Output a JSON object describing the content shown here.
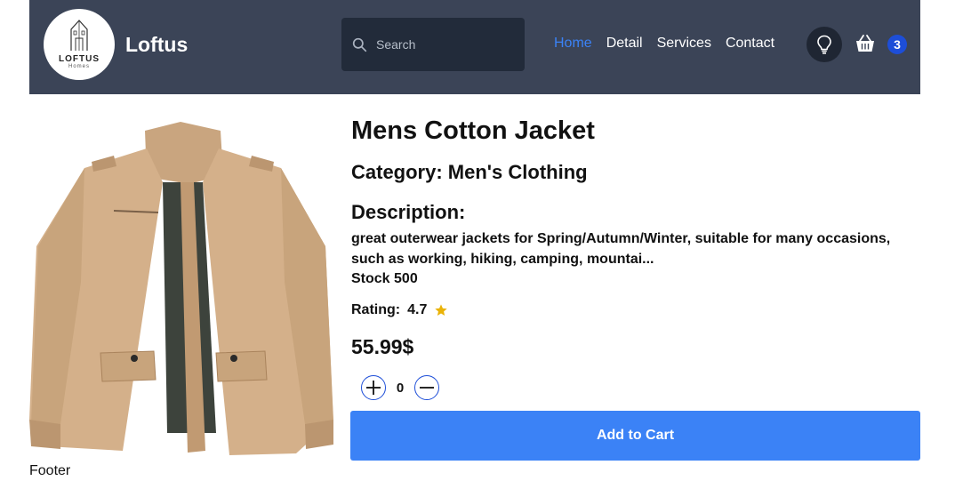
{
  "header": {
    "brand": "Loftus",
    "logo_text": "LOFTUS",
    "logo_subtext": "Homes",
    "search": {
      "placeholder": "Search"
    },
    "nav": [
      {
        "label": "Home",
        "active": true
      },
      {
        "label": "Detail",
        "active": false
      },
      {
        "label": "Services",
        "active": false
      },
      {
        "label": "Contact",
        "active": false
      }
    ],
    "cart_count": "3"
  },
  "product": {
    "title": "Mens Cotton Jacket",
    "category": "Category: Men's Clothing",
    "description_heading": "Description:",
    "description": "great outerwear jackets for Spring/Autumn/Winter, suitable for many occasions, such as working, hiking, camping, mountai...",
    "stock": "Stock 500",
    "rating_label": "Rating:",
    "rating_value": "4.7",
    "price": "55.99$",
    "quantity": "0",
    "add_to_cart_label": "Add to Cart"
  },
  "footer": {
    "text": "Footer"
  },
  "colors": {
    "navbar_bg": "#3b4457",
    "search_bg": "#222b3a",
    "accent": "#3b82f6",
    "badge_bg": "#1d4ed8",
    "star": "#eab308"
  },
  "icons": [
    "logo-house-icon",
    "search-icon",
    "lightbulb-icon",
    "basket-icon",
    "star-icon",
    "plus-icon",
    "minus-icon"
  ]
}
